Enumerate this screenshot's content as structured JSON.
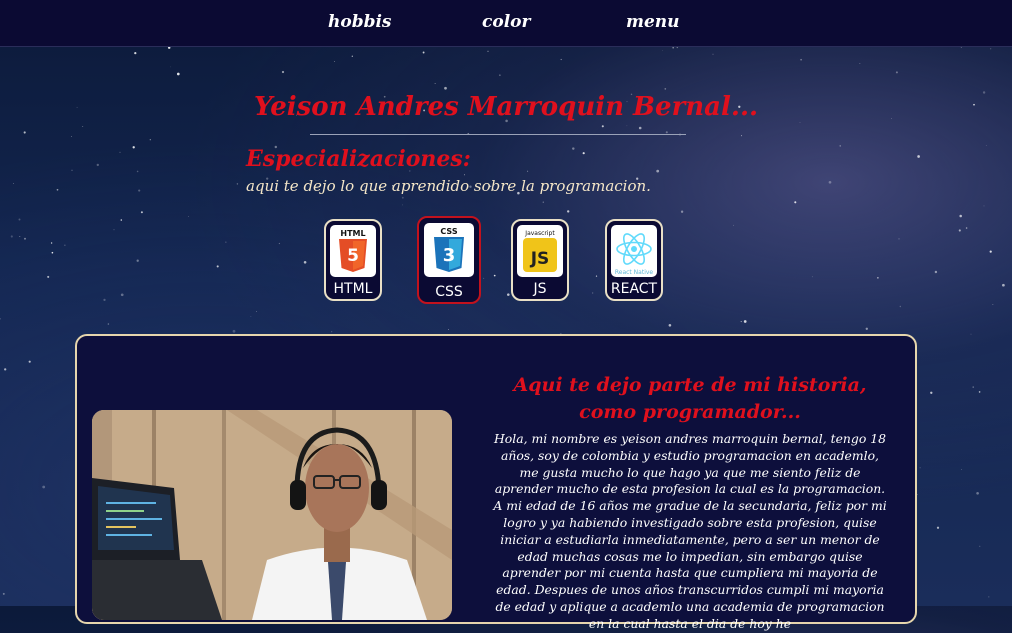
{
  "nav": {
    "items": [
      "hobbis",
      "color",
      "menu"
    ]
  },
  "header": {
    "title": "Yeison Andres Marroquin Bernal..."
  },
  "specializations": {
    "heading": "Especializaciones:",
    "subtitle": "aqui te dejo lo que aprendido sobre la programacion.",
    "items": [
      {
        "label": "HTML",
        "badge": "HTML",
        "icon": "html5-icon",
        "color": "#e44d26",
        "active": false
      },
      {
        "label": "CSS",
        "badge": "CSS",
        "icon": "css3-icon",
        "color": "#1b73ba",
        "active": true
      },
      {
        "label": "JS",
        "badge": "Javascript",
        "icon": "javascript-icon",
        "color": "#f0c419",
        "active": false
      },
      {
        "label": "REACT",
        "badge": "React Native",
        "icon": "react-icon",
        "color": "#61dafb",
        "active": false
      }
    ]
  },
  "story": {
    "title": "Aqui te dejo parte de mi historia, como programador...",
    "text": "Hola, mi nombre es yeison andres marroquin bernal, tengo 18 años, soy de colombia y estudio programacion en academlo, me gusta mucho lo que hago ya que me siento feliz de aprender mucho de esta profesion la cual es la programacion. A mi edad de 16 años me gradue de la secundaria, feliz por mi logro y ya habiendo investigado sobre esta profesion, quise iniciar a estudiarla inmediatamente, pero a ser un menor de edad muchas cosas me lo impedian, sin embargo quise aprender por mi cuenta hasta que cumpliera mi mayoria de edad. Despues de unos años transcurridos cumpli mi mayoria de edad y aplique a academlo una academia de programacion en la cual hasta el dia de hoy he"
  },
  "colors": {
    "accent": "#e0101d",
    "nav_bg": "#0b0a33",
    "text_light": "#f4e6c8"
  }
}
